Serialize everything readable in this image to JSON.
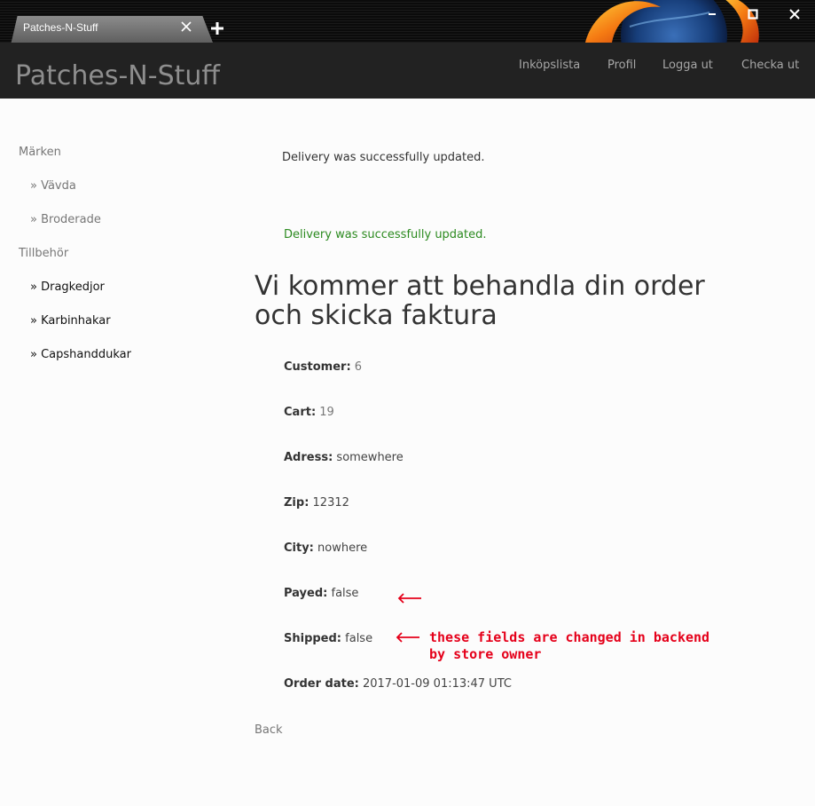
{
  "browser": {
    "tab_title": "Patches-N-Stuff"
  },
  "navbar": {
    "brand": "Patches-N-Stuff",
    "links": [
      "Inköpslista",
      "Profil",
      "Logga ut",
      "Checka ut"
    ]
  },
  "sidebar": {
    "sections": [
      {
        "label": "Märken",
        "items": [
          "» Vävda",
          "» Broderade"
        ]
      },
      {
        "label": "Tillbehör",
        "items": [
          "» Dragkedjor",
          "» Karbinhakar",
          "» Capshanddukar"
        ]
      }
    ]
  },
  "notices": {
    "plain": "Delivery was successfully updated.",
    "success": "Delivery was successfully updated."
  },
  "order": {
    "heading": "Vi kommer att behandla din order och skicka faktura",
    "fields": [
      {
        "label": "Customer:",
        "value": "6"
      },
      {
        "label": "Cart:",
        "value": "19"
      },
      {
        "label": "Adress:",
        "value": "somewhere"
      },
      {
        "label": "Zip:",
        "value": "12312"
      },
      {
        "label": "City:",
        "value": "nowhere"
      },
      {
        "label": "Payed:",
        "value": "false"
      },
      {
        "label": "Shipped:",
        "value": "false"
      },
      {
        "label": "Order date:",
        "value": "2017-01-09 01:13:47 UTC"
      }
    ],
    "back_label": "Back"
  },
  "annotation": {
    "text_line1": "these fields are changed in backend",
    "text_line2": "by store owner",
    "color": "#e5001a"
  }
}
